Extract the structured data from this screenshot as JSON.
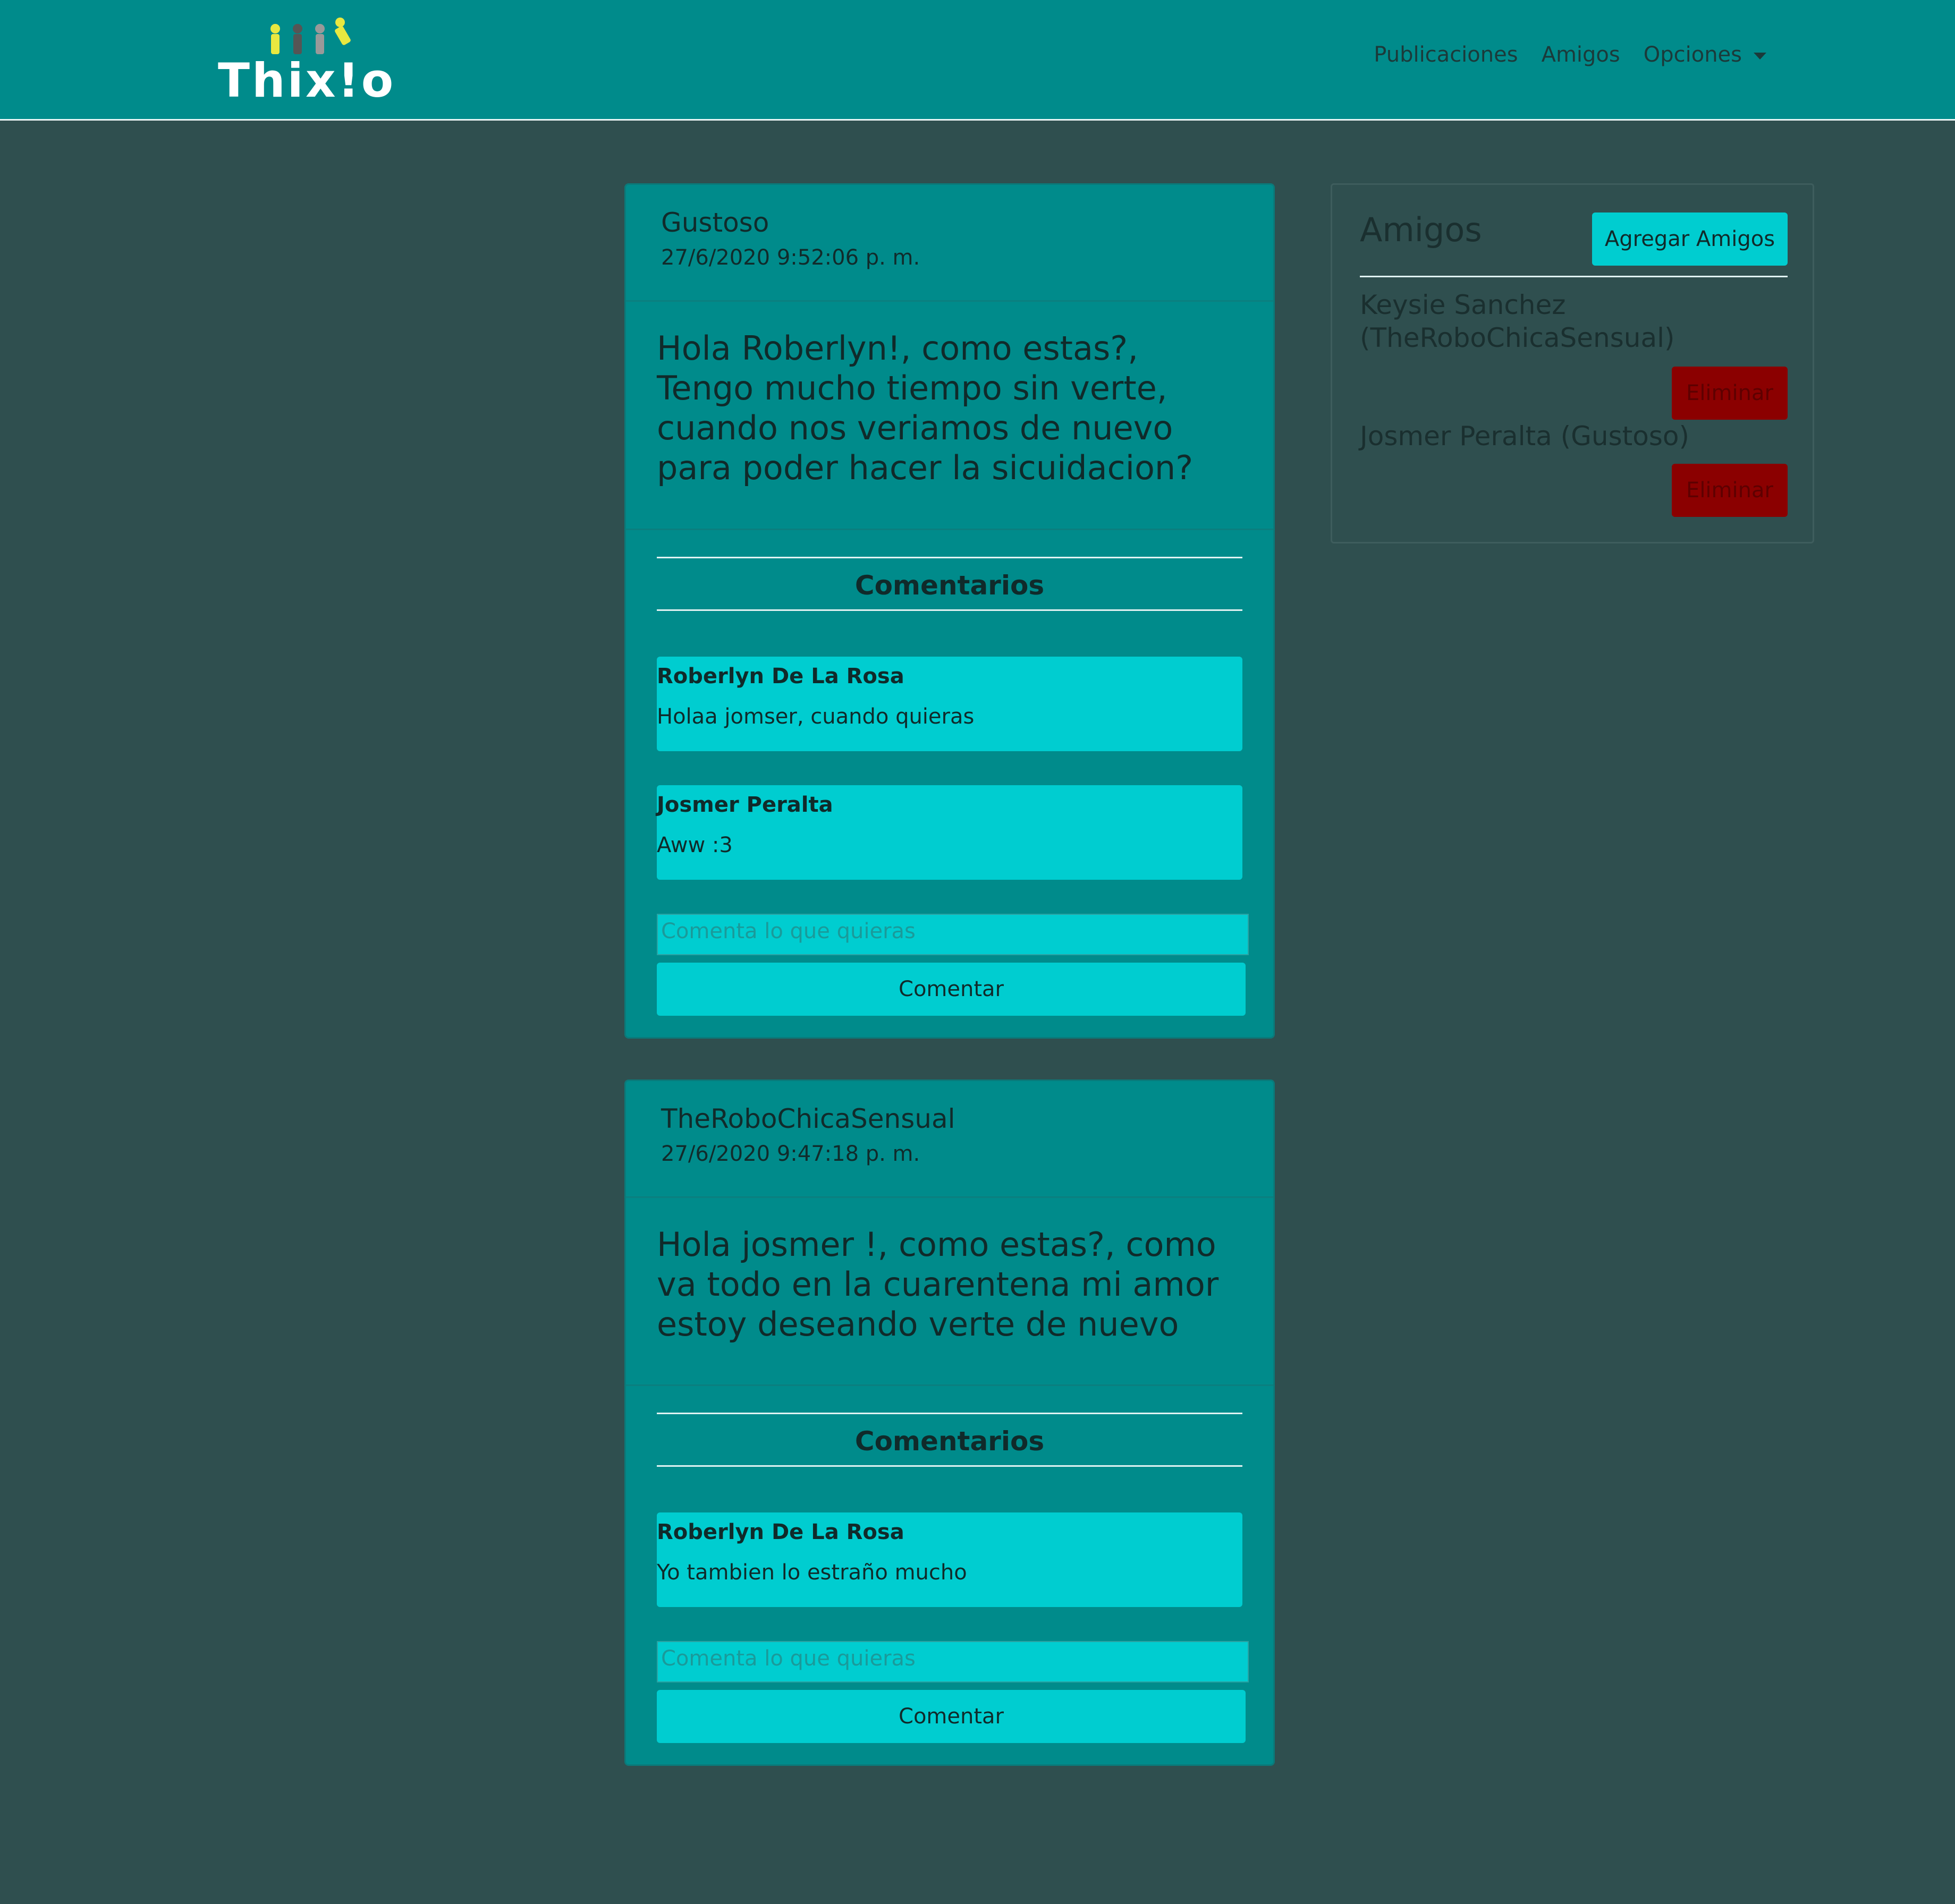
{
  "brand": {
    "name": "Thix!o"
  },
  "nav": {
    "links": [
      "Publicaciones",
      "Amigos",
      "Opciones"
    ]
  },
  "posts": [
    {
      "user": "Gustoso",
      "date": "27/6/2020 9:52:06 p. m.",
      "body": "Hola Roberlyn!, como estas?, Tengo mucho tiempo sin verte, cuando nos veriamos de nuevo para poder hacer la sicuidacion?",
      "comments_title": "Comentarios",
      "comments": [
        {
          "author": "Roberlyn De La Rosa",
          "text": "Holaa jomser, cuando quieras"
        },
        {
          "author": "Josmer Peralta",
          "text": "Aww :3"
        }
      ],
      "input_placeholder": "Comenta lo que quieras",
      "button_label": "Comentar"
    },
    {
      "user": "TheRoboChicaSensual",
      "date": "27/6/2020 9:47:18 p. m.",
      "body": "Hola josmer !, como estas?, como va todo en la cuarentena mi amor estoy deseando verte de nuevo",
      "comments_title": "Comentarios",
      "comments": [
        {
          "author": "Roberlyn De La Rosa",
          "text": "Yo tambien lo estraño mucho"
        }
      ],
      "input_placeholder": "Comenta lo que quieras",
      "button_label": "Comentar"
    }
  ],
  "friends": {
    "title": "Amigos",
    "add_label": "Agregar Amigos",
    "list": [
      {
        "name": "Keysie Sanchez (TheRoboChicaSensual)",
        "delete_label": "Eliminar"
      },
      {
        "name": "Josmer Peralta (Gustoso)",
        "delete_label": "Eliminar"
      }
    ]
  },
  "colors": {
    "page_bg": "#2f4f4f",
    "navbar_bg": "#008b8b",
    "card_bg": "#008b8b",
    "accent": "#00cdd0",
    "danger": "#8b0000"
  }
}
